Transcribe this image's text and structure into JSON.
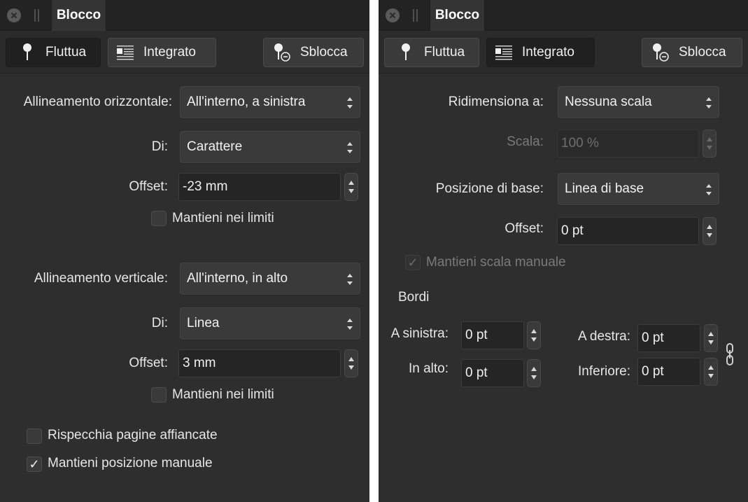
{
  "left_panel": {
    "tab_title": "Blocco",
    "toolbar": {
      "float_label": "Fluttua",
      "inline_label": "Integrato",
      "unlock_label": "Sblocca"
    },
    "horizontal": {
      "align_label": "Allineamento orizzontale:",
      "align_value": "All'interno, a sinistra",
      "from_label": "Di:",
      "from_value": "Carattere",
      "offset_label": "Offset:",
      "offset_value": "-23 mm",
      "keep_label": "Mantieni nei limiti",
      "keep_checked": false
    },
    "vertical": {
      "align_label": "Allineamento verticale:",
      "align_value": "All'interno, in alto",
      "from_label": "Di:",
      "from_value": "Linea",
      "offset_label": "Offset:",
      "offset_value": "3 mm",
      "keep_label": "Mantieni nei limiti",
      "keep_checked": false
    },
    "mirror_label": "Rispecchia pagine affiancate",
    "mirror_checked": false,
    "manual_pos_label": "Mantieni posizione manuale",
    "manual_pos_checked": true
  },
  "right_panel": {
    "tab_title": "Blocco",
    "toolbar": {
      "float_label": "Fluttua",
      "inline_label": "Integrato",
      "unlock_label": "Sblocca"
    },
    "resize_label": "Ridimensiona a:",
    "resize_value": "Nessuna scala",
    "scale_label": "Scala:",
    "scale_value": "100 %",
    "base_pos_label": "Posizione di base:",
    "base_pos_value": "Linea di base",
    "offset_label": "Offset:",
    "offset_value": "0 pt",
    "manual_scale_label": "Mantieni scala manuale",
    "manual_scale_checked": true,
    "borders": {
      "section_label": "Bordi",
      "left_label": "A sinistra:",
      "left_value": "0 pt",
      "right_label": "A destra:",
      "right_value": "0 pt",
      "top_label": "In alto:",
      "top_value": "0 pt",
      "bottom_label": "Inferiore:",
      "bottom_value": "0 pt"
    }
  },
  "icons": {
    "close": "close-icon",
    "float": "pin-icon",
    "inline": "inline-text-icon",
    "unlock": "pin-minus-icon",
    "link": "chain-link-icon",
    "checkmark": "✓"
  },
  "colors": {
    "panel_bg": "#2e2e2e",
    "titlebar_bg": "#232323",
    "text": "#e6e6e6",
    "dim_text": "#7a7a7a"
  }
}
